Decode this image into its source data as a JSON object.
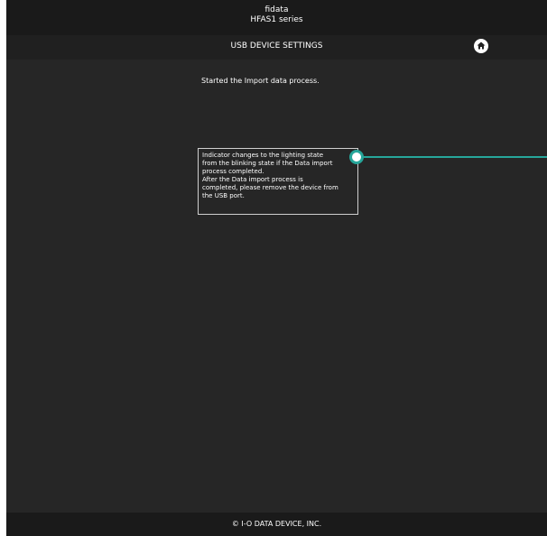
{
  "header": {
    "brand": "fidata",
    "model": "HFAS1 series"
  },
  "nav": {
    "title": "USB DEVICE SETTINGS",
    "home_icon": "home-icon"
  },
  "main": {
    "status": "Started the Import data process.",
    "callout_lines": [
      "Indicator changes to the lighting state",
      "from the blinking state if the Data import",
      "process completed.",
      "After the Data import process is",
      "completed, please remove the device from",
      "the USB port."
    ]
  },
  "footer": {
    "copyright": "© I-O DATA DEVICE, INC."
  },
  "colors": {
    "accent": "#26a69a",
    "background": "#262626"
  }
}
